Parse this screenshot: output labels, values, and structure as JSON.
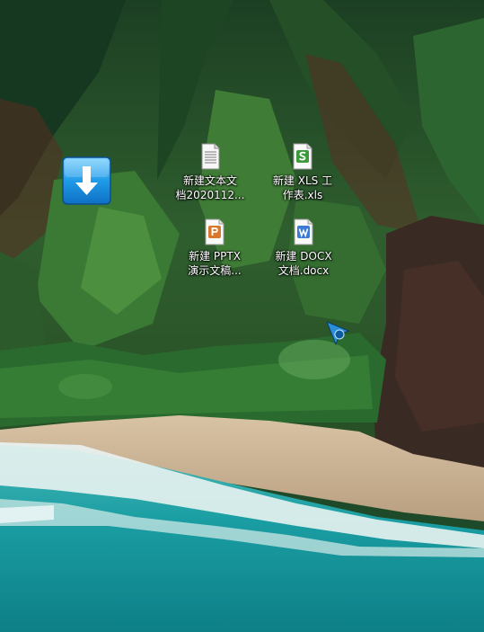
{
  "desktop": {
    "icons": [
      {
        "label_line1": "新建文本文",
        "label_line2": "档2020112...",
        "icon": "text-file-icon"
      },
      {
        "label_line1": "新建 XLS 工",
        "label_line2": "作表.xls",
        "icon": "xls-file-icon"
      },
      {
        "label_line1": "新建 PPTX",
        "label_line2": "演示文稿...",
        "icon": "pptx-file-icon"
      },
      {
        "label_line1": "新建 DOCX",
        "label_line2": "文档.docx",
        "icon": "docx-file-icon"
      }
    ],
    "download_icon": "download-arrow-icon",
    "cursor_icon": "pointer-cursor-icon"
  },
  "colors": {
    "xls_accent": "#3c9a3c",
    "pptx_accent": "#d9772b",
    "docx_accent": "#3a7bd5",
    "download_blue": "#1a8fe0",
    "sea": "#1aa5a8",
    "sand": "#cdb79a",
    "foliage": "#2e6b34"
  }
}
